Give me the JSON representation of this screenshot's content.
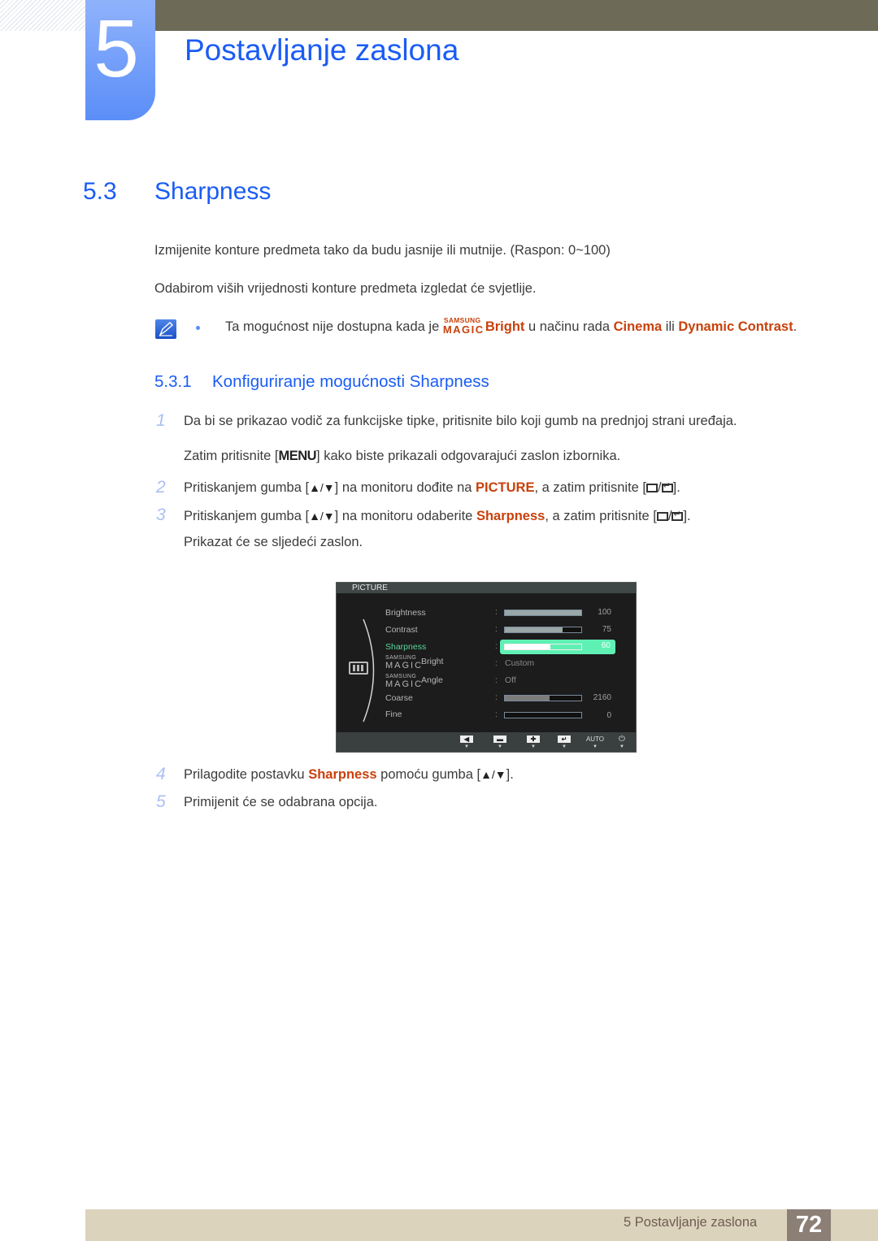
{
  "chapter": {
    "number": "5",
    "title": "Postavljanje zaslona"
  },
  "section": {
    "number": "5.3",
    "title": "Sharpness",
    "paragraphs": [
      "Izmijenite konture predmeta tako da budu jasnije ili mutnije. (Raspon: 0~100)",
      "Odabirom viših vrijednosti konture predmeta izgledat će svjetlije."
    ],
    "note": {
      "prefix": "Ta mogućnost nije dostupna kada je ",
      "magic_small": "SAMSUNG",
      "magic_big": "MAGIC",
      "magic_word": "Bright",
      "middle": " u načinu rada ",
      "mode1": "Cinema",
      "joiner": " ili ",
      "mode2": "Dynamic Contrast",
      "suffix": "."
    }
  },
  "subsection": {
    "number": "5.3.1",
    "title": "Konfiguriranje mogućnosti Sharpness"
  },
  "steps": [
    {
      "num": "1",
      "text": "Da bi se prikazao vodič za funkcijske tipke, pritisnite bilo koji gumb na prednjoj strani uređaja.",
      "continuation_pre": "Zatim pritisnite [",
      "key": "MENU",
      "continuation_post": "] kako biste prikazali odgovarajući zaslon izbornika."
    },
    {
      "num": "2",
      "pre": "Pritiskanjem gumba [",
      "arrows": "▲/▼",
      "mid": "] na monitoru dođite na ",
      "hl": "PICTURE",
      "post": ", a zatim pritisnite [",
      "end": "]."
    },
    {
      "num": "3",
      "pre": "Pritiskanjem gumba [",
      "arrows": "▲/▼",
      "mid": "] na monitoru odaberite ",
      "hl": "Sharpness",
      "post": ", a zatim pritisnite [",
      "end": "].",
      "continuation": "Prikazat će se sljedeći zaslon."
    },
    {
      "num": "4",
      "pre": "Prilagodite postavku ",
      "hl": "Sharpness",
      "mid": " pomoću gumba [",
      "arrows": "▲/▼",
      "end": "]."
    },
    {
      "num": "5",
      "text": "Primijenit će se odabrana opcija."
    }
  ],
  "osd": {
    "header": "PICTURE",
    "items": [
      {
        "label": "Brightness",
        "type": "bar",
        "value": "100",
        "fill_fraction": 1.0
      },
      {
        "label": "Contrast",
        "type": "bar",
        "value": "75",
        "fill_fraction": 0.75
      },
      {
        "label": "Sharpness",
        "type": "bar",
        "value": "60",
        "fill_fraction": 0.6,
        "active": true
      },
      {
        "label": "Bright",
        "magic_small": "SAMSUNG",
        "magic_big": "MAGIC",
        "type": "text",
        "value": "Custom"
      },
      {
        "label": "Angle",
        "magic_small": "SAMSUNG",
        "magic_big": "MAGIC",
        "type": "text",
        "value": "Off"
      },
      {
        "label": "Coarse",
        "type": "bar",
        "value": "2160",
        "fill_fraction": 0.58
      },
      {
        "label": "Fine",
        "type": "bar",
        "value": "0",
        "fill_fraction": 0.0
      }
    ],
    "footer_buttons": [
      {
        "icon": "left-arrow-icon",
        "glyph": "◀"
      },
      {
        "icon": "minus-icon",
        "glyph": "▬"
      },
      {
        "icon": "plus-icon",
        "glyph": "✚"
      },
      {
        "icon": "enter-icon",
        "glyph": "↵"
      },
      {
        "icon": "auto-label",
        "glyph": "AUTO"
      },
      {
        "icon": "power-icon",
        "glyph": "⏻"
      }
    ],
    "footer_arrow": "▼"
  },
  "footer": {
    "label": "5 Postavljanje zaslona",
    "page": "72"
  }
}
